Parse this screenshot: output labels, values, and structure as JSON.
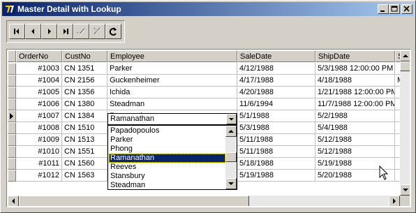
{
  "window": {
    "title": "Master Detail with Lookup",
    "titlebar_gradient": [
      "#0a246a",
      "#a6caf0"
    ]
  },
  "caption_buttons": [
    "minimize-icon",
    "maximize-icon",
    "close-icon"
  ],
  "navigator": {
    "buttons": [
      {
        "name": "first-record-button",
        "icon": "first-icon",
        "enabled": true
      },
      {
        "name": "prior-record-button",
        "icon": "prior-icon",
        "enabled": true
      },
      {
        "name": "next-record-button",
        "icon": "next-icon",
        "enabled": true
      },
      {
        "name": "last-record-button",
        "icon": "last-icon",
        "enabled": true
      },
      {
        "name": "post-edit-button",
        "icon": "checkmark-icon",
        "enabled": false
      },
      {
        "name": "cancel-edit-button",
        "icon": "x-icon",
        "enabled": false
      },
      {
        "name": "refresh-button",
        "icon": "refresh-icon",
        "enabled": true
      }
    ]
  },
  "grid": {
    "columns": [
      "OrderNo",
      "CustNo",
      "Employee",
      "SaleDate",
      "ShipDate",
      "S"
    ],
    "rows": [
      {
        "order": "#1003",
        "cust": "CN 1351",
        "employee": "Parker",
        "sale": "4/12/1988",
        "ship": "5/3/1988 12:00:00 PM",
        "extra": ""
      },
      {
        "order": "#1004",
        "cust": "CN 2156",
        "employee": "Guckenheimer",
        "sale": "4/17/1988",
        "ship": "4/18/1988",
        "extra": "M"
      },
      {
        "order": "#1005",
        "cust": "CN 1356",
        "employee": "Ichida",
        "sale": "4/20/1988",
        "ship": "1/21/1988 12:00:00 PM",
        "extra": ""
      },
      {
        "order": "#1006",
        "cust": "CN 1380",
        "employee": "Steadman",
        "sale": "11/6/1994",
        "ship": "11/7/1988 12:00:00 PM",
        "extra": ""
      },
      {
        "order": "#1007",
        "cust": "CN 1384",
        "employee": "Ramanathan",
        "sale": "5/1/1988",
        "ship": "5/2/1988",
        "extra": ""
      },
      {
        "order": "#1008",
        "cust": "CN 1510",
        "employee": "",
        "sale": "5/3/1988",
        "ship": "5/4/1988",
        "extra": ""
      },
      {
        "order": "#1009",
        "cust": "CN 1513",
        "employee": "",
        "sale": "5/11/1988",
        "ship": "5/12/1988",
        "extra": ""
      },
      {
        "order": "#1010",
        "cust": "CN 1551",
        "employee": "",
        "sale": "5/11/1988",
        "ship": "5/12/1988",
        "extra": ""
      },
      {
        "order": "#1011",
        "cust": "CN 1560",
        "employee": "",
        "sale": "5/18/1988",
        "ship": "5/19/1988",
        "extra": ""
      },
      {
        "order": "#1012",
        "cust": "CN 1563",
        "employee": "",
        "sale": "5/19/1988",
        "ship": "5/20/1988",
        "extra": ""
      }
    ],
    "current_row_index": 4
  },
  "lookup": {
    "current_value": "Ramanathan",
    "items": [
      "Papadopoulos",
      "Parker",
      "Phong",
      "Ramanathan",
      "Reeves",
      "Stansbury",
      "Steadman"
    ],
    "selected_index": 3,
    "selection_color": "#0a246a"
  }
}
